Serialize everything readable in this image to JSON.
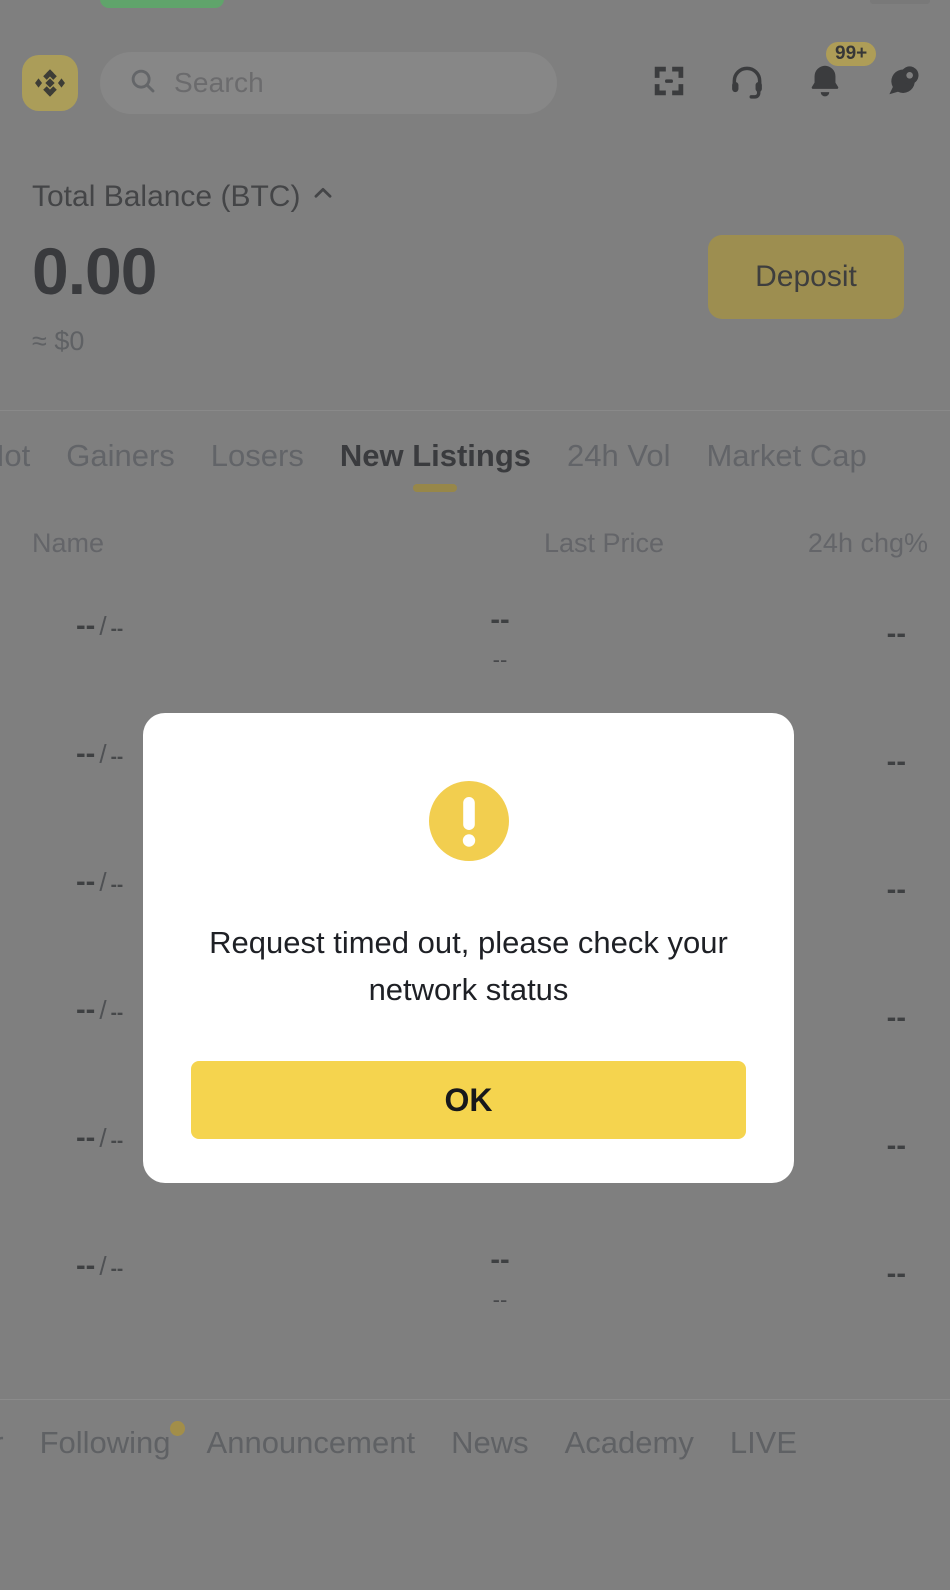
{
  "statusbar": {
    "indicator": "recording-pill"
  },
  "header": {
    "logo_icon": "binance-logo-icon",
    "search": {
      "placeholder": "Search",
      "value": "",
      "icon": "search-icon"
    },
    "actions": [
      {
        "name": "scan-icon",
        "label": ""
      },
      {
        "name": "support-headset-icon",
        "label": ""
      },
      {
        "name": "notification-bell-icon",
        "label": "",
        "badge": "99+"
      },
      {
        "name": "chat-profile-icon",
        "label": ""
      }
    ]
  },
  "balance": {
    "label": "Total Balance (BTC)",
    "toggle_icon": "chevron-up-icon",
    "value": "0.00",
    "approx": "≈ $0",
    "deposit_label": "Deposit"
  },
  "market": {
    "tabs": [
      {
        "label": "Hot",
        "active": false
      },
      {
        "label": "Gainers",
        "active": false
      },
      {
        "label": "Losers",
        "active": false
      },
      {
        "label": "New Listings",
        "active": true
      },
      {
        "label": "24h Vol",
        "active": false
      },
      {
        "label": "Market Cap",
        "active": false
      }
    ],
    "columns": {
      "name": "Name",
      "last_price": "Last Price",
      "change": "24h chg%"
    },
    "rows": [
      {
        "base": "--",
        "sep": "/",
        "quote": "--",
        "price": "--",
        "price_sub": "--",
        "change": "--"
      },
      {
        "base": "--",
        "sep": "/",
        "quote": "--",
        "price": "--",
        "price_sub": "--",
        "change": "--"
      },
      {
        "base": "--",
        "sep": "/",
        "quote": "--",
        "price": "--",
        "price_sub": "--",
        "change": "--"
      },
      {
        "base": "--",
        "sep": "/",
        "quote": "--",
        "price": "--",
        "price_sub": "--",
        "change": "--"
      },
      {
        "base": "--",
        "sep": "/",
        "quote": "--",
        "price": "--",
        "price_sub": "--",
        "change": "--"
      },
      {
        "base": "--",
        "sep": "/",
        "quote": "--",
        "price": "--",
        "price_sub": "--",
        "change": "--"
      }
    ]
  },
  "bottom_nav": {
    "items": [
      {
        "label": "er",
        "dot": false
      },
      {
        "label": "Following",
        "dot": true
      },
      {
        "label": "Announcement",
        "dot": false
      },
      {
        "label": "News",
        "dot": false
      },
      {
        "label": "Academy",
        "dot": false
      },
      {
        "label": "LIVE",
        "dot": false
      }
    ]
  },
  "modal": {
    "icon": "warning-exclamation-icon",
    "message": "Request timed out, please check your network status",
    "confirm_label": "OK"
  },
  "colors": {
    "brand_yellow": "#F0B90B",
    "modal_yellow": "#F5D44E",
    "page_background": "#8C8C8C",
    "accent_underline": "#B59A2F",
    "status_green": "#4DD764"
  }
}
